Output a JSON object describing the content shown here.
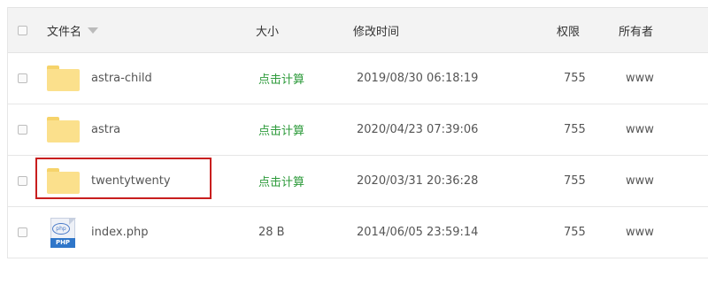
{
  "columns": {
    "name": "文件名",
    "size": "大小",
    "modified": "修改时间",
    "permissions": "权限",
    "owner": "所有者"
  },
  "rows": [
    {
      "name": "astra-child",
      "type": "folder",
      "size": "点击计算",
      "modified": "2019/08/30 06:18:19",
      "permissions": "755",
      "owner": "www"
    },
    {
      "name": "astra",
      "type": "folder",
      "size": "点击计算",
      "modified": "2020/04/23 07:39:06",
      "permissions": "755",
      "owner": "www"
    },
    {
      "name": "twentytwenty",
      "type": "folder",
      "size": "点击计算",
      "modified": "2020/03/31 20:36:28",
      "permissions": "755",
      "owner": "www"
    },
    {
      "name": "index.php",
      "type": "php-file",
      "size": "28 B",
      "modified": "2014/06/05 23:59:14",
      "permissions": "755",
      "owner": "www"
    }
  ],
  "php_icon": {
    "badge": "php",
    "label": "PHP"
  },
  "colors": {
    "calc_link": "#2c9a3a",
    "highlight": "#c81e1e",
    "folder": "#fbe08c"
  }
}
